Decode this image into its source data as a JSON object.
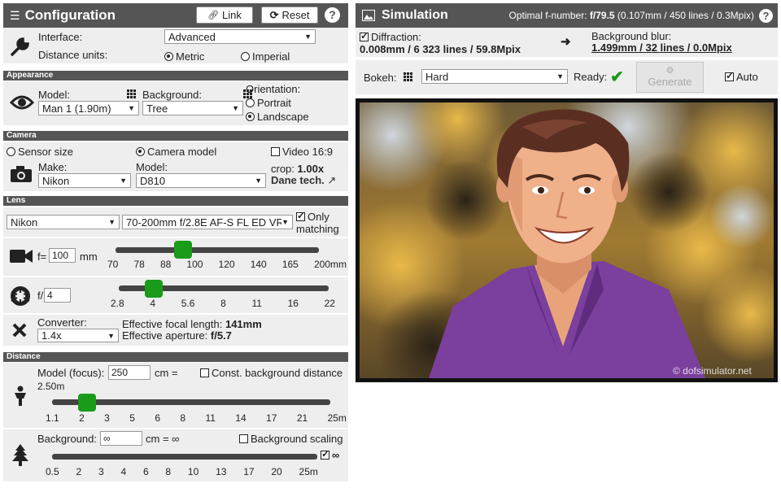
{
  "config": {
    "title": "Configuration",
    "link_label": "Link",
    "reset_label": "Reset",
    "interface_label": "Interface:",
    "interface_value": "Advanced",
    "units_label": "Distance units:",
    "units_metric": "Metric",
    "units_imperial": "Imperial"
  },
  "appearance": {
    "section": "Appearance",
    "model_label": "Model:",
    "model_value": "Man 1 (1.90m)",
    "background_label": "Background:",
    "background_value": "Tree",
    "orientation_label": "Orientation:",
    "portrait": "Portrait",
    "landscape": "Landscape"
  },
  "camera": {
    "section": "Camera",
    "sensor_size": "Sensor size",
    "camera_model": "Camera model",
    "video": "Video 16:9",
    "make_label": "Make:",
    "make_value": "Nikon",
    "model_label": "Model:",
    "model_value": "D810",
    "crop_label": "crop:",
    "crop_value": "1.00x",
    "dane": "Dane tech."
  },
  "lens": {
    "section": "Lens",
    "make_value": "Nikon",
    "lens_value": "70-200mm f/2.8E AF-S FL ED VR",
    "only_matching_1": "Only",
    "only_matching_2": "matching",
    "focal_prefix": "f=",
    "focal_value": "100",
    "focal_unit": "mm",
    "focal_ticks": [
      "70",
      "78",
      "88",
      "100",
      "120",
      "140",
      "165",
      "200mm"
    ],
    "focal_fraction": 0.333,
    "aperture_prefix": "f/",
    "aperture_value": "4",
    "aperture_ticks": [
      "2.8",
      "4",
      "5.6",
      "8",
      "11",
      "16",
      "22"
    ],
    "aperture_fraction": 0.167,
    "converter_label": "Converter:",
    "converter_value": "1.4x",
    "eff_focal_label": "Effective focal length:",
    "eff_focal_value": "141mm",
    "eff_aperture_label": "Effective aperture:",
    "eff_aperture_value": "f/5.7"
  },
  "distance": {
    "section": "Distance",
    "model_label": "Model (focus):",
    "model_value": "250",
    "model_unit": "cm =",
    "model_converted": "2.50m",
    "const_bg": "Const. background distance",
    "model_ticks": [
      "1.1",
      "2",
      "3",
      "5",
      "6",
      "8",
      "11",
      "14",
      "17",
      "21",
      "25m"
    ],
    "model_fraction": 0.127,
    "bg_label": "Background:",
    "bg_value": "∞",
    "bg_unit": "cm = ∞",
    "bg_scaling": "Background scaling",
    "bg_infinity": "∞",
    "bg_ticks": [
      "0.5",
      "2",
      "3",
      "4",
      "6",
      "8",
      "10",
      "13",
      "17",
      "20",
      "25m"
    ]
  },
  "simulation": {
    "title": "Simulation",
    "optimal_label": "Optimal f-number:",
    "optimal_value": "f/79.5",
    "optimal_detail": "(0.107mm / 450 lines / 0.3Mpix)",
    "diffraction_label": "Diffraction:",
    "diffraction_value": "0.008mm / 6 323 lines / 59.8Mpix",
    "blur_label": "Background blur:",
    "blur_value": "1.499mm / 32 lines / 0.0Mpix",
    "bokeh_label": "Bokeh:",
    "bokeh_value": "Hard",
    "ready_label": "Ready:",
    "generate_label": "Generate",
    "auto_label": "Auto",
    "watermark": "© dofsimulator.net"
  },
  "colors": {
    "header": "#555555",
    "knob": "#1a9b1a",
    "panel": "#eeeeee",
    "shirt": "#7b3f9e"
  }
}
